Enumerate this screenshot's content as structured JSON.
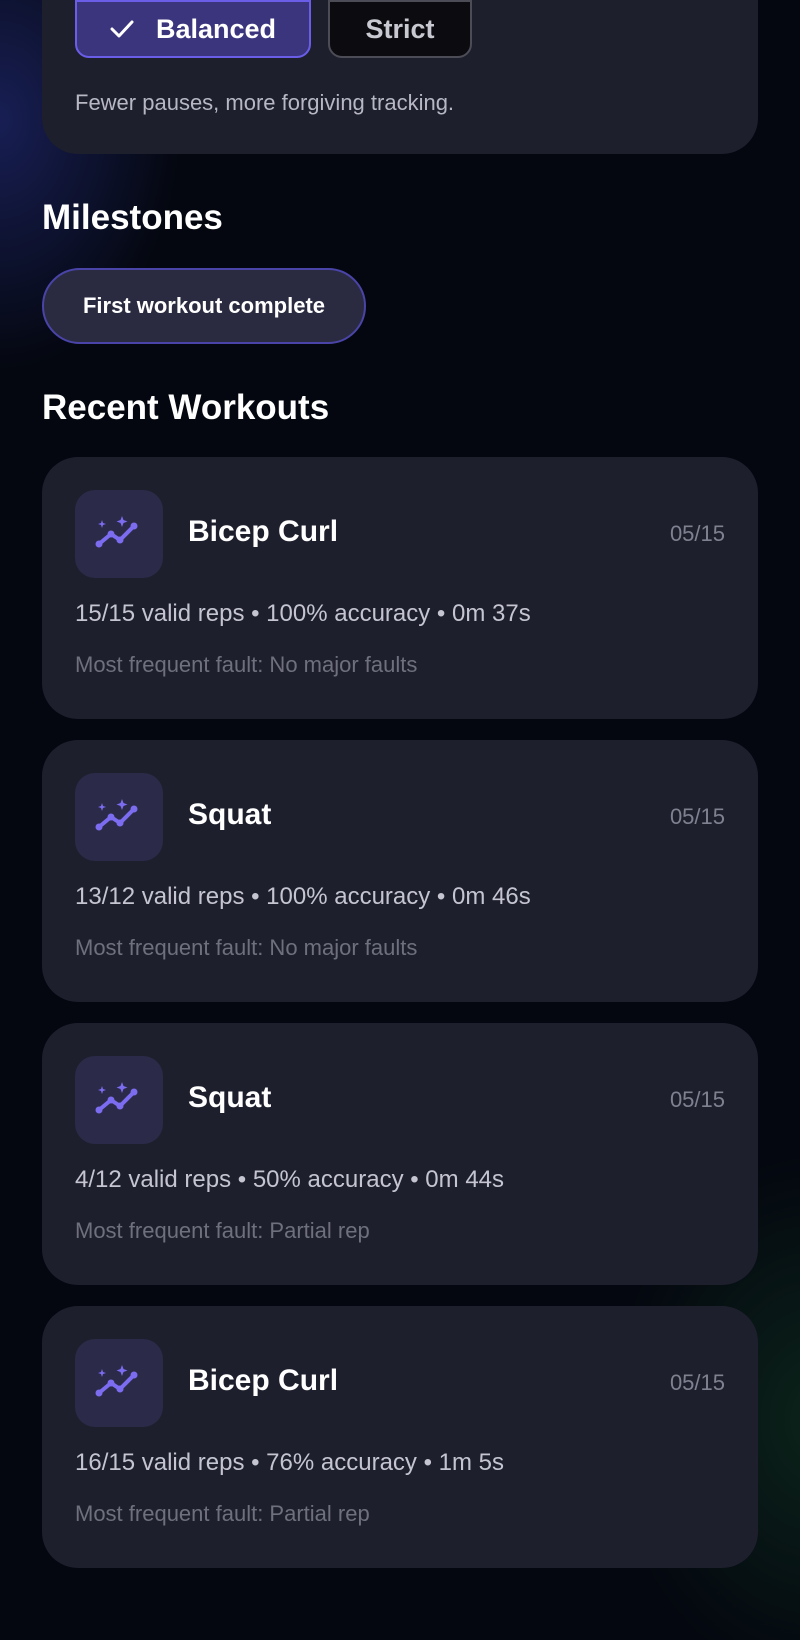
{
  "mode": {
    "options": [
      {
        "label": "Balanced",
        "selected": true
      },
      {
        "label": "Strict",
        "selected": false
      }
    ],
    "description": "Fewer pauses, more forgiving tracking."
  },
  "milestones": {
    "title": "Milestones",
    "chips": [
      "First workout complete"
    ]
  },
  "recent": {
    "title": "Recent Workouts",
    "items": [
      {
        "name": "Bicep Curl",
        "date": "05/15",
        "stats": "15/15 valid reps • 100% accuracy • 0m 37s",
        "fault": "Most frequent fault: No major faults"
      },
      {
        "name": "Squat",
        "date": "05/15",
        "stats": "13/12 valid reps • 100% accuracy • 0m 46s",
        "fault": "Most frequent fault: No major faults"
      },
      {
        "name": "Squat",
        "date": "05/15",
        "stats": "4/12 valid reps • 50% accuracy • 0m 44s",
        "fault": "Most frequent fault: Partial rep"
      },
      {
        "name": "Bicep Curl",
        "date": "05/15",
        "stats": "16/15 valid reps • 76% accuracy • 1m 5s",
        "fault": "Most frequent fault: Partial rep"
      }
    ]
  },
  "theme": {
    "accent": "#6a5ee8",
    "icon_color": "#7b6cf0",
    "card_bg": "#1e1f2d"
  },
  "icons": {
    "selected_check": "check-icon",
    "workout": "trend-sparkle-icon"
  }
}
